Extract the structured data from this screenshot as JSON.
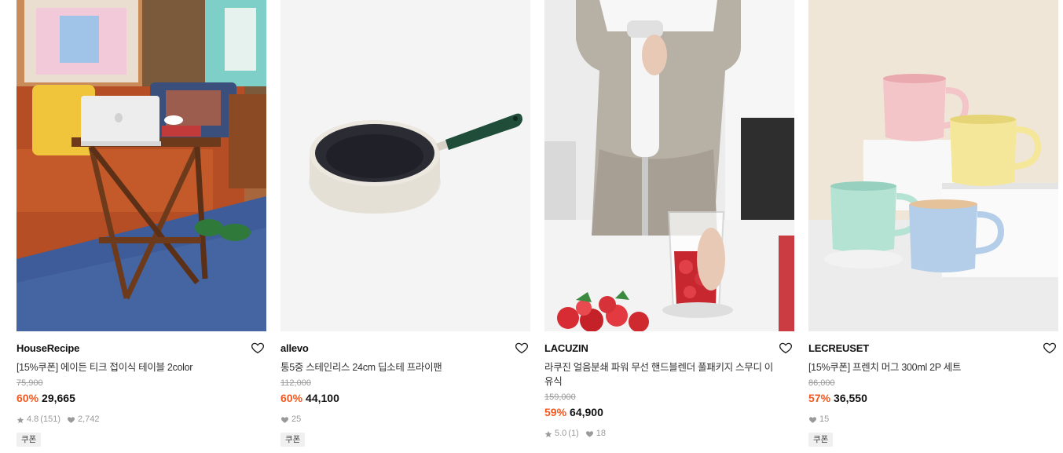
{
  "products": [
    {
      "brand": "HouseRecipe",
      "title": "[15%쿠폰] 에이든 티크 접이식 테이블 2color",
      "original_price": "75,900",
      "discount": "60%",
      "price": "29,665",
      "rating": "4.8",
      "reviews": "(151)",
      "likes": "2,742",
      "badge": "쿠폰",
      "image": "living room with folding teak table and laptop"
    },
    {
      "brand": "allevo",
      "title": "통5중 스테인리스 24cm 딥소테 프라이팬",
      "original_price": "112,000",
      "discount": "60%",
      "price": "44,100",
      "rating": "",
      "reviews": "",
      "likes": "25",
      "badge": "쿠폰",
      "image": "stainless frying pan with green handle"
    },
    {
      "brand": "LACUZIN",
      "title": "라쿠진 얼음분쇄 파워 무선 핸드블렌더 풀패키지 스무디 이유식",
      "original_price": "159,000",
      "discount": "59%",
      "price": "64,900",
      "rating": "5.0",
      "reviews": "(1)",
      "likes": "18",
      "badge": "",
      "image": "hand blender with strawberries"
    },
    {
      "brand": "LECREUSET",
      "title": "[15%쿠폰] 프렌치 머그 300ml 2P 세트",
      "original_price": "86,000",
      "discount": "57%",
      "price": "36,550",
      "rating": "",
      "reviews": "",
      "likes": "15",
      "badge": "쿠폰",
      "image": "pastel stoneware mugs"
    }
  ],
  "icons": {
    "like": "heart-outline-icon",
    "star": "star-icon",
    "likes_count": "heart-filled-icon"
  },
  "colors": {
    "discount": "#f05a22",
    "meta": "#9a9a9a"
  }
}
